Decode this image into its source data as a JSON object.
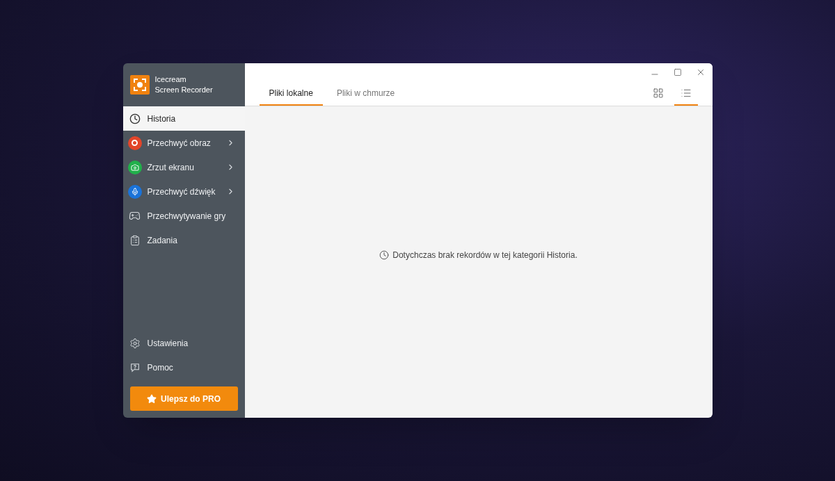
{
  "app": {
    "name_line_1": "Icecream",
    "name_line_2": "Screen Recorder"
  },
  "sidebar": {
    "items": [
      {
        "kind": "history",
        "label": "Historia",
        "selected": true,
        "submenu": false
      },
      {
        "kind": "record",
        "label": "Przechwyć obraz",
        "selected": false,
        "submenu": true
      },
      {
        "kind": "screenshot",
        "label": "Zrzut ekranu",
        "selected": false,
        "submenu": true
      },
      {
        "kind": "audio",
        "label": "Przechwyć dźwięk",
        "selected": false,
        "submenu": true
      },
      {
        "kind": "game",
        "label": "Przechwytywanie gry",
        "selected": false,
        "submenu": false
      },
      {
        "kind": "tasks",
        "label": "Zadania",
        "selected": false,
        "submenu": false
      }
    ],
    "bottom_items": [
      {
        "kind": "settings",
        "label": "Ustawienia"
      },
      {
        "kind": "help",
        "label": "Pomoc"
      }
    ],
    "upgrade_button": "Ulepsz do PRO"
  },
  "tabs": [
    {
      "label": "Pliki lokalne",
      "selected": true
    },
    {
      "label": "Pliki w chmurze",
      "selected": false
    }
  ],
  "view_toggles": [
    {
      "kind": "grid",
      "selected": false
    },
    {
      "kind": "list",
      "selected": true
    }
  ],
  "empty_message": "Dotychczas brak rekordów w tej kategorii Historia."
}
